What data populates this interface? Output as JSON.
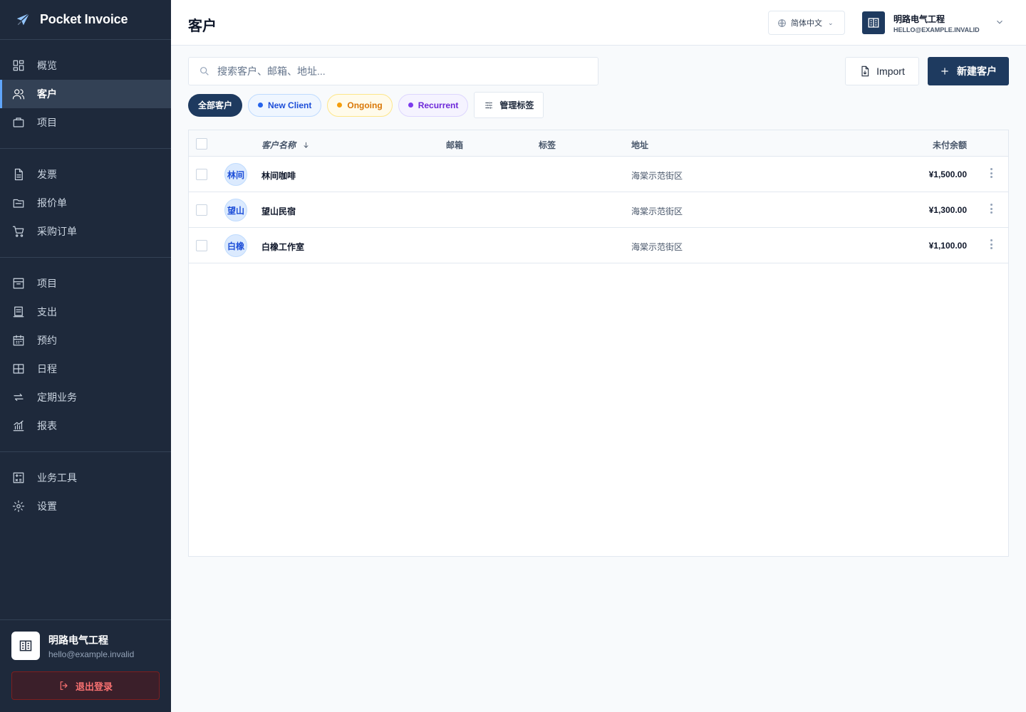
{
  "brand": {
    "title": "Pocket Invoice"
  },
  "sidebar": {
    "groups": [
      [
        {
          "label": "概览",
          "icon": "grid-icon"
        },
        {
          "label": "客户",
          "icon": "users-icon",
          "active": true
        },
        {
          "label": "项目",
          "icon": "briefcase-icon"
        }
      ],
      [
        {
          "label": "发票",
          "icon": "file-icon"
        },
        {
          "label": "报价单",
          "icon": "folder-icon"
        },
        {
          "label": "采购订单",
          "icon": "cart-icon"
        }
      ],
      [
        {
          "label": "项目",
          "icon": "archive-icon"
        },
        {
          "label": "支出",
          "icon": "receipt-icon"
        },
        {
          "label": "预约",
          "icon": "calendar-icon"
        },
        {
          "label": "日程",
          "icon": "table-icon"
        },
        {
          "label": "定期业务",
          "icon": "repeat-icon"
        },
        {
          "label": "报表",
          "icon": "chart-icon"
        }
      ],
      [
        {
          "label": "业务工具",
          "icon": "calculator-icon"
        },
        {
          "label": "设置",
          "icon": "gear-icon"
        }
      ]
    ],
    "footer": {
      "name": "明路电气工程",
      "email": "hello@example.invalid",
      "logout_label": "退出登录"
    }
  },
  "header": {
    "title": "客户",
    "language": "简体中文",
    "account_name": "明路电气工程",
    "account_email": "HELLO@EXAMPLE.INVALID"
  },
  "toolbar": {
    "search_placeholder": "搜索客户、邮箱、地址...",
    "import_label": "Import",
    "new_label": "新建客户"
  },
  "filters": {
    "all_label": "全部客户",
    "tags": [
      {
        "label": "New Client",
        "color": "#2563eb"
      },
      {
        "label": "Ongoing",
        "color": "#f59e0b"
      },
      {
        "label": "Recurrent",
        "color": "#7c3aed"
      }
    ],
    "manage_label": "管理标签"
  },
  "table": {
    "columns": {
      "name": "客户名称",
      "email": "邮箱",
      "tags": "标签",
      "address": "地址",
      "balance": "未付余额"
    },
    "rows": [
      {
        "initials": "林间",
        "name": "林间咖啡",
        "email": "",
        "tags": "",
        "address": "海棠示范街区",
        "balance": "¥1,500.00"
      },
      {
        "initials": "望山",
        "name": "望山民宿",
        "email": "",
        "tags": "",
        "address": "海棠示范街区",
        "balance": "¥1,300.00"
      },
      {
        "initials": "白橡",
        "name": "白橡工作室",
        "email": "",
        "tags": "",
        "address": "海棠示范街区",
        "balance": "¥1,100.00"
      }
    ]
  },
  "colors": {
    "sidebar_bg": "#1e293b",
    "primary": "#1e3a5f",
    "danger": "#f87171"
  }
}
